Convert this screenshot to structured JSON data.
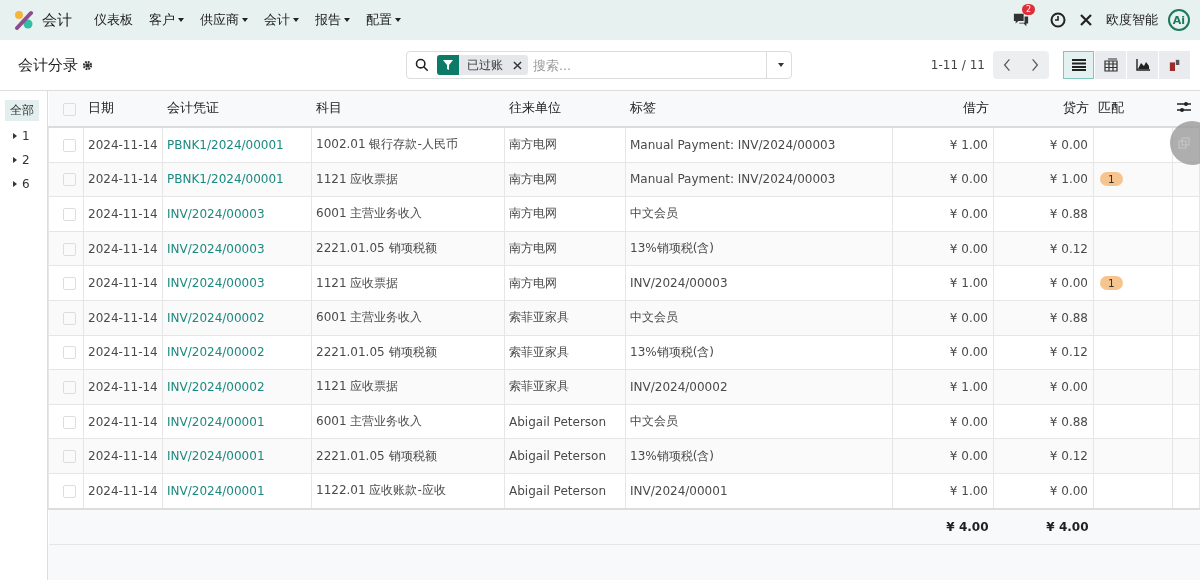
{
  "navbar": {
    "app_name": "会计",
    "menus": [
      {
        "label": "仪表板",
        "dropdown": false
      },
      {
        "label": "客户",
        "dropdown": true
      },
      {
        "label": "供应商",
        "dropdown": true
      },
      {
        "label": "会计",
        "dropdown": true
      },
      {
        "label": "报告",
        "dropdown": true
      },
      {
        "label": "配置",
        "dropdown": true
      }
    ],
    "message_count": "2",
    "company": "欧度智能",
    "avatar": "Ai"
  },
  "control_panel": {
    "title": "会计分录",
    "facets": [
      {
        "label": "已过账"
      }
    ],
    "search": {
      "placeholder": "搜索..."
    },
    "pager": "1-11 / 11",
    "views": [
      {
        "kind": "list",
        "selected": true
      },
      {
        "kind": "pivot",
        "selected": false
      },
      {
        "kind": "graph",
        "selected": false
      },
      {
        "kind": "activity",
        "selected": false
      }
    ]
  },
  "sidebar": {
    "items": [
      {
        "label": "全部",
        "selected": true,
        "expandable": false
      },
      {
        "label": "1",
        "selected": false,
        "expandable": true
      },
      {
        "label": "2",
        "selected": false,
        "expandable": true
      },
      {
        "label": "6",
        "selected": false,
        "expandable": true
      }
    ]
  },
  "table": {
    "select_all": false,
    "columns": [
      "日期",
      "会计凭证",
      "科目",
      "往来单位",
      "标签",
      "借方",
      "贷方",
      "匹配"
    ],
    "rows": [
      {
        "selected": false,
        "date": "2024-11-14",
        "move": "PBNK1/2024/00001",
        "account": "1002.01 银行存款-人民币",
        "partner": "南方电网",
        "label": "Manual Payment: INV/2024/00003",
        "debit": "¥ 1.00",
        "credit": "¥ 0.00"
      },
      {
        "selected": false,
        "date": "2024-11-14",
        "move": "PBNK1/2024/00001",
        "account": "1121 应收票据",
        "partner": "南方电网",
        "label": "Manual Payment: INV/2024/00003",
        "debit": "¥ 0.00",
        "credit": "¥ 1.00",
        "matching": "1"
      },
      {
        "selected": false,
        "date": "2024-11-14",
        "move": "INV/2024/00003",
        "account": "6001 主营业务收入",
        "partner": "南方电网",
        "label": "中文会员",
        "debit": "¥ 0.00",
        "credit": "¥ 0.88"
      },
      {
        "selected": false,
        "date": "2024-11-14",
        "move": "INV/2024/00003",
        "account": "2221.01.05 销项税额",
        "partner": "南方电网",
        "label": "13%销项税(含)",
        "debit": "¥ 0.00",
        "credit": "¥ 0.12"
      },
      {
        "selected": false,
        "date": "2024-11-14",
        "move": "INV/2024/00003",
        "account": "1121 应收票据",
        "partner": "南方电网",
        "label": "INV/2024/00003",
        "debit": "¥ 1.00",
        "credit": "¥ 0.00",
        "matching": "1"
      },
      {
        "selected": false,
        "date": "2024-11-14",
        "move": "INV/2024/00002",
        "account": "6001 主营业务收入",
        "partner": "索菲亚家具",
        "label": "中文会员",
        "debit": "¥ 0.00",
        "credit": "¥ 0.88"
      },
      {
        "selected": false,
        "date": "2024-11-14",
        "move": "INV/2024/00002",
        "account": "2221.01.05 销项税额",
        "partner": "索菲亚家具",
        "label": "13%销项税(含)",
        "debit": "¥ 0.00",
        "credit": "¥ 0.12"
      },
      {
        "selected": false,
        "date": "2024-11-14",
        "move": "INV/2024/00002",
        "account": "1121 应收票据",
        "partner": "索菲亚家具",
        "label": "INV/2024/00002",
        "debit": "¥ 1.00",
        "credit": "¥ 0.00"
      },
      {
        "selected": false,
        "date": "2024-11-14",
        "move": "INV/2024/00001",
        "account": "6001 主营业务收入",
        "partner": "Abigail Peterson",
        "label": "中文会员",
        "debit": "¥ 0.00",
        "credit": "¥ 0.88"
      },
      {
        "selected": false,
        "date": "2024-11-14",
        "move": "INV/2024/00001",
        "account": "2221.01.05 销项税额",
        "partner": "Abigail Peterson",
        "label": "13%销项税(含)",
        "debit": "¥ 0.00",
        "credit": "¥ 0.12"
      },
      {
        "selected": false,
        "date": "2024-11-14",
        "move": "INV/2024/00001",
        "account": "1122.01 应收账款-应收",
        "partner": "Abigail Peterson",
        "label": "INV/2024/00001",
        "debit": "¥ 1.00",
        "credit": "¥ 0.00"
      }
    ],
    "totals": {
      "debit": "¥ 4.00",
      "credit": "¥ 4.00"
    }
  }
}
